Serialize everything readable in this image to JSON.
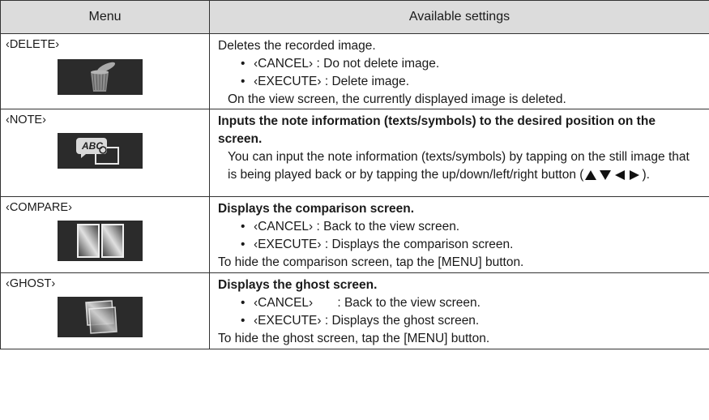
{
  "header": {
    "menu": "Menu",
    "settings": "Available settings"
  },
  "rows": [
    {
      "menu": "‹DELETE›",
      "icon": "trash-can-icon",
      "lines": [
        "Deletes the recorded image.",
        "‹CANCEL› : Do not delete image.",
        "‹EXECUTE› : Delete image.",
        "On the view screen, the currently displayed image is deleted."
      ]
    },
    {
      "menu": "‹NOTE›",
      "icon": "note-abc-icon",
      "icon_text": "ABC",
      "title": "Inputs the note information (texts/symbols) to the desired position on the screen.",
      "body": "You can input the note information (texts/symbols) by tapping on the still image that is being played back or by tapping the up/down/left/right button (",
      "body_end": ")."
    },
    {
      "menu": "‹COMPARE›",
      "icon": "compare-screens-icon",
      "title": "Displays the comparison screen.",
      "lines": [
        "‹CANCEL› : Back to the view screen.",
        "‹EXECUTE› : Displays the comparison screen.",
        "To hide the comparison screen, tap the [MENU] button."
      ]
    },
    {
      "menu": "‹GHOST›",
      "icon": "ghost-screens-icon",
      "title": "Displays the ghost screen.",
      "lines": [
        "‹CANCEL›       : Back to the view screen.",
        "‹EXECUTE› : Displays the ghost screen.",
        "To hide the ghost screen, tap the [MENU] button."
      ]
    }
  ]
}
